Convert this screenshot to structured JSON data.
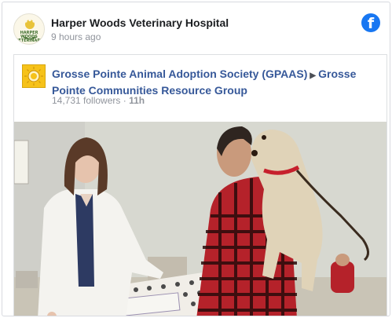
{
  "post": {
    "page_name": "Harper Woods Veterinary Hospital",
    "time": "9 hours ago",
    "avatar_text_line1": "HARPER WOODS",
    "avatar_text_line2": "VETERINARY"
  },
  "shared": {
    "group_a": "Grosse Pointe Animal Adoption Society (GPAAS)",
    "group_b": "Grosse Pointe Communities Resource Group",
    "followers": "14,731 followers",
    "separator": " · ",
    "time": "11h"
  },
  "icons": {
    "brand": "facebook-icon",
    "arrow": "triangle-right-icon",
    "brand_color": "#1877f2"
  },
  "photo": {
    "icon": "photo-image"
  }
}
